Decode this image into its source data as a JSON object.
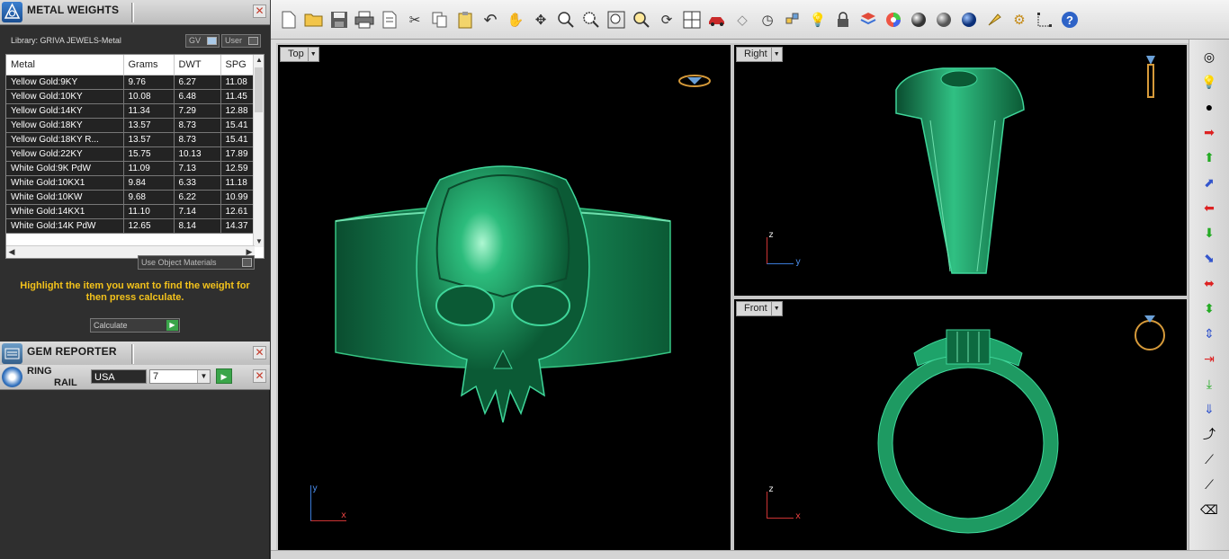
{
  "metal_weights": {
    "title": "METAL WEIGHTS",
    "library_label": "Library: GRIVA JEWELS-Metal",
    "toggle_gv": "GV",
    "toggle_user": "User",
    "columns": [
      "Metal",
      "Grams",
      "DWT",
      "SPG"
    ],
    "rows": [
      [
        "Yellow Gold:9KY",
        "9.76",
        "6.27",
        "11.08"
      ],
      [
        "Yellow Gold:10KY",
        "10.08",
        "6.48",
        "11.45"
      ],
      [
        "Yellow Gold:14KY",
        "11.34",
        "7.29",
        "12.88"
      ],
      [
        "Yellow Gold:18KY",
        "13.57",
        "8.73",
        "15.41"
      ],
      [
        "Yellow Gold:18KY R...",
        "13.57",
        "8.73",
        "15.41"
      ],
      [
        "Yellow Gold:22KY",
        "15.75",
        "10.13",
        "17.89"
      ],
      [
        "White Gold:9K PdW",
        "11.09",
        "7.13",
        "12.59"
      ],
      [
        "White Gold:10KX1",
        "9.84",
        "6.33",
        "11.18"
      ],
      [
        "White Gold:10KW",
        "9.68",
        "6.22",
        "10.99"
      ],
      [
        "White Gold:14KX1",
        "11.10",
        "7.14",
        "12.61"
      ],
      [
        "White Gold:14K PdW",
        "12.65",
        "8.14",
        "14.37"
      ]
    ],
    "use_object_materials": "Use Object Materials",
    "hint": "Highlight the item you want to find the weight for then press calculate.",
    "calculate": "Calculate"
  },
  "gem_reporter": {
    "title": "GEM REPORTER"
  },
  "ring_rail": {
    "title_line1": "RING",
    "title_line2": "RAIL",
    "region": "USA",
    "size": "7"
  },
  "viewports": {
    "top": "Top",
    "right": "Right",
    "front": "Front"
  },
  "colors": {
    "model_green": "#1c8f5c",
    "accent_yellow": "#f3c21b",
    "viewport_bg": "#000000"
  }
}
